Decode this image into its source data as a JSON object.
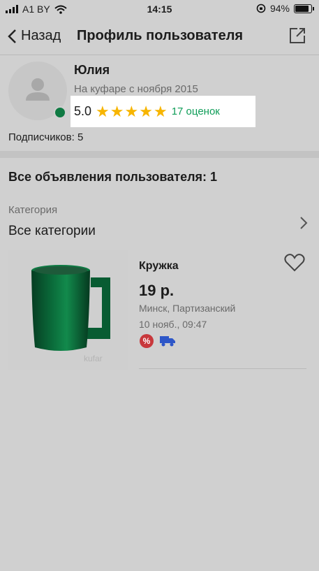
{
  "status_bar": {
    "carrier": "A1 BY",
    "time": "14:15",
    "battery": "94%"
  },
  "nav": {
    "back_label": "Назад",
    "title": "Профиль пользователя"
  },
  "profile": {
    "name": "Юлия",
    "since": "На куфаре с ноября 2015",
    "rating": "5.0",
    "stars": [
      "★",
      "★",
      "★",
      "★",
      "★"
    ],
    "reviews": "17 оценок",
    "subscribers": "Подписчиков: 5"
  },
  "listings": {
    "heading": "Все объявления пользователя: 1",
    "category_label": "Категория",
    "category_value": "Все категории",
    "items": [
      {
        "title": "Кружка",
        "price": "19 р.",
        "location": "Минск, Партизанский",
        "date": "10 нояб., 09:47",
        "discount_badge": "%",
        "watermark": "kufar"
      }
    ]
  },
  "colors": {
    "online": "#0f7a43",
    "star": "#f7b500",
    "reviews_link": "#0f9d58",
    "mug": "#0a6b3a"
  }
}
